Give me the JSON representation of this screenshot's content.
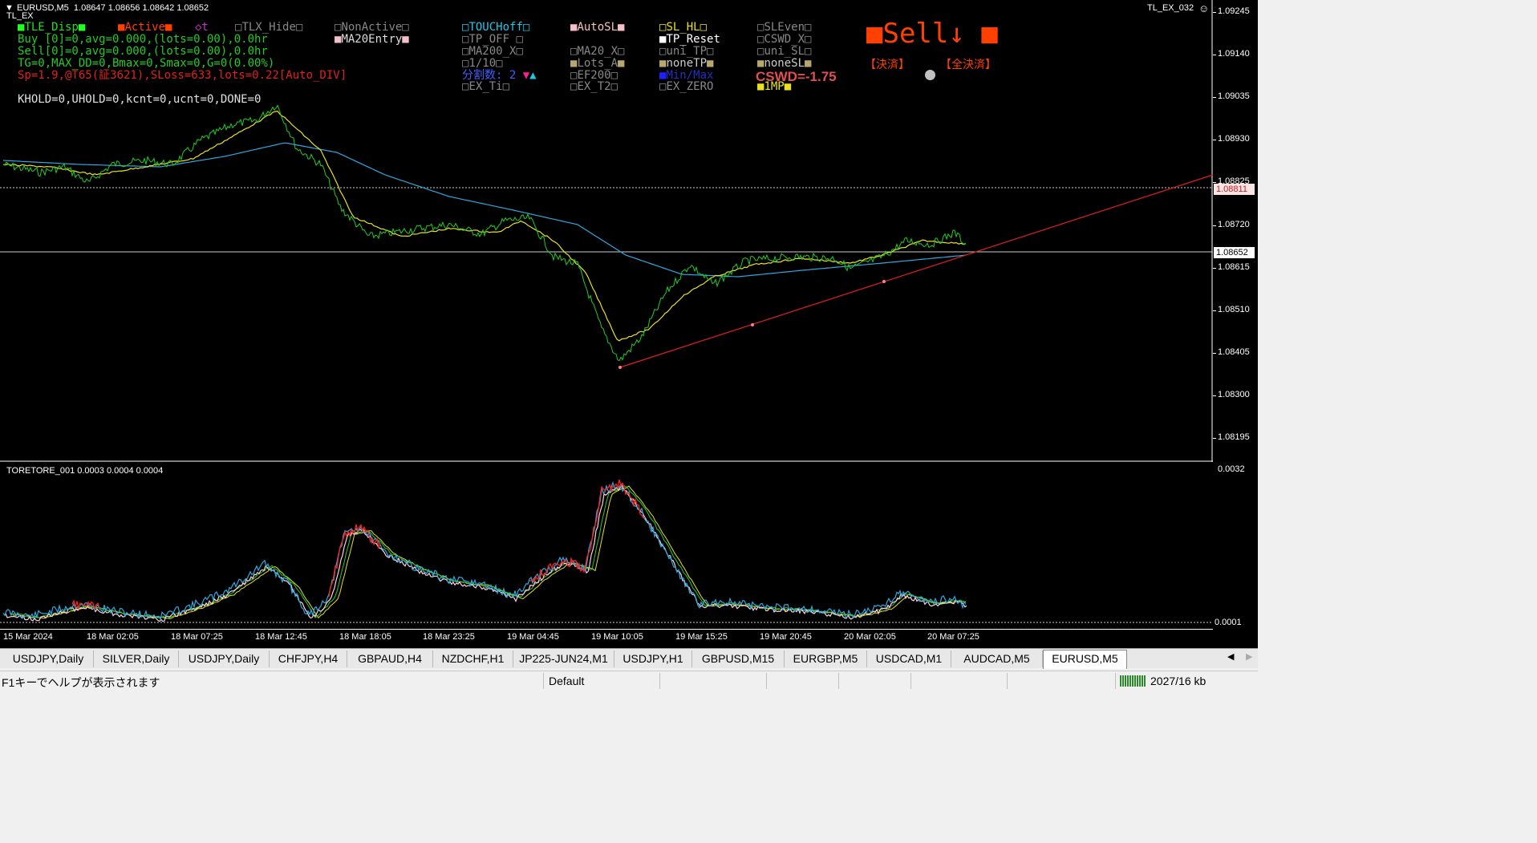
{
  "chart_header": {
    "symbol_line": "EURUSD,M5  1.08647 1.08656 1.08642 1.08652",
    "ea_name": "TL_EX",
    "ea_right": "TL_EX_032",
    "smiley": "☺"
  },
  "panel_left": {
    "tle_disp": "TLE_Disp",
    "active": "Active",
    "t_label": "◇t",
    "buy_line": "Buy [0]=0,avg=0.000,(lots=0.00),0.0hr",
    "sell_line": "Sell[0]=0,avg=0.000,(lots=0.00),0.0hr",
    "tg_line": "TG=0,MAX_DD=0,Bmax=0,Smax=0,G=0(0.00%)",
    "sp_line": "Sp=1.9,@T65(証3621),SLoss=633,lots=0.22[Auto_DIV]",
    "khold_line": "KHOLD=0,UHOLD=0,kcnt=0,ucnt=0,DONE=0"
  },
  "panel_checks": {
    "tlx_hide": "TLX_Hide",
    "nonactive": "NonActive",
    "ma20entry": "MA20Entry",
    "touchoff": "TOUCHoff",
    "tp_off": "TP_OFF",
    "ma200_x": "MA200_X",
    "one_ten": "1/10",
    "split": "分割数: 2",
    "ex_ti": "EX_Ti",
    "autosl": "AutoSL",
    "ma20_x": "MA20_X",
    "lots_a": "Lots_A",
    "ef200": "EF200",
    "ex_t2": "EX_T2",
    "sl_hl": "SL_HL",
    "tp_reset": "TP_Reset",
    "uni_tp": "uni_TP",
    "nonetp": "noneTP",
    "minmax": "Min/Max",
    "ex_zero": "EX_ZERO",
    "sleven": "SLEven",
    "cswd_x": "CSWD_X",
    "uni_sl": "uni_SL",
    "nonesl": "noneSL",
    "cswd_value": "CSWD=-1.75",
    "one_mp": "1MP",
    "sell_big": "Sell↓",
    "kessai": "【決済】",
    "zen_kessai": "【全決済】"
  },
  "price_axis": {
    "ticks": [
      "1.09245",
      "1.09140",
      "1.09035",
      "1.08930",
      "1.08825",
      "1.08720",
      "1.08615",
      "1.08510",
      "1.08405",
      "1.08300",
      "1.08195"
    ],
    "hline_price": "1.08811",
    "bid_price": "1.08652"
  },
  "indicator": {
    "title": "TORETORE_001 0.0003 0.0004 0.0004",
    "top_value": "0.0032",
    "bottom_value": "0.0001"
  },
  "time_axis": [
    "15 Mar 2024",
    "18 Mar 02:05",
    "18 Mar 07:25",
    "18 Mar 12:45",
    "18 Mar 18:05",
    "18 Mar 23:25",
    "19 Mar 04:45",
    "19 Mar 10:05",
    "19 Mar 15:25",
    "19 Mar 20:45",
    "20 Mar 02:05",
    "20 Mar 07:25"
  ],
  "tabs": [
    "USDJPY,Daily",
    "SILVER,Daily",
    "USDJPY,Daily",
    "CHFJPY,H4",
    "GBPAUD,H4",
    "NZDCHF,H1",
    "JP225-JUN24,M1",
    "USDJPY,H1",
    "GBPUSD,M15",
    "EURGBP,M5",
    "USDCAD,M1",
    "AUDCAD,M5",
    "EURUSD,M5"
  ],
  "tab_nav": {
    "left": "◀",
    "right": "▶"
  },
  "status": {
    "help": "F1キーでヘルプが表示されます",
    "profile": "Default",
    "traffic": "2027/16 kb"
  },
  "colors": {
    "price_green": "#22cc22",
    "ma_yellow": "#e8e020",
    "ma_blue": "#2fa8e0",
    "trend_red": "#e02020",
    "orange": "#ff4000"
  }
}
